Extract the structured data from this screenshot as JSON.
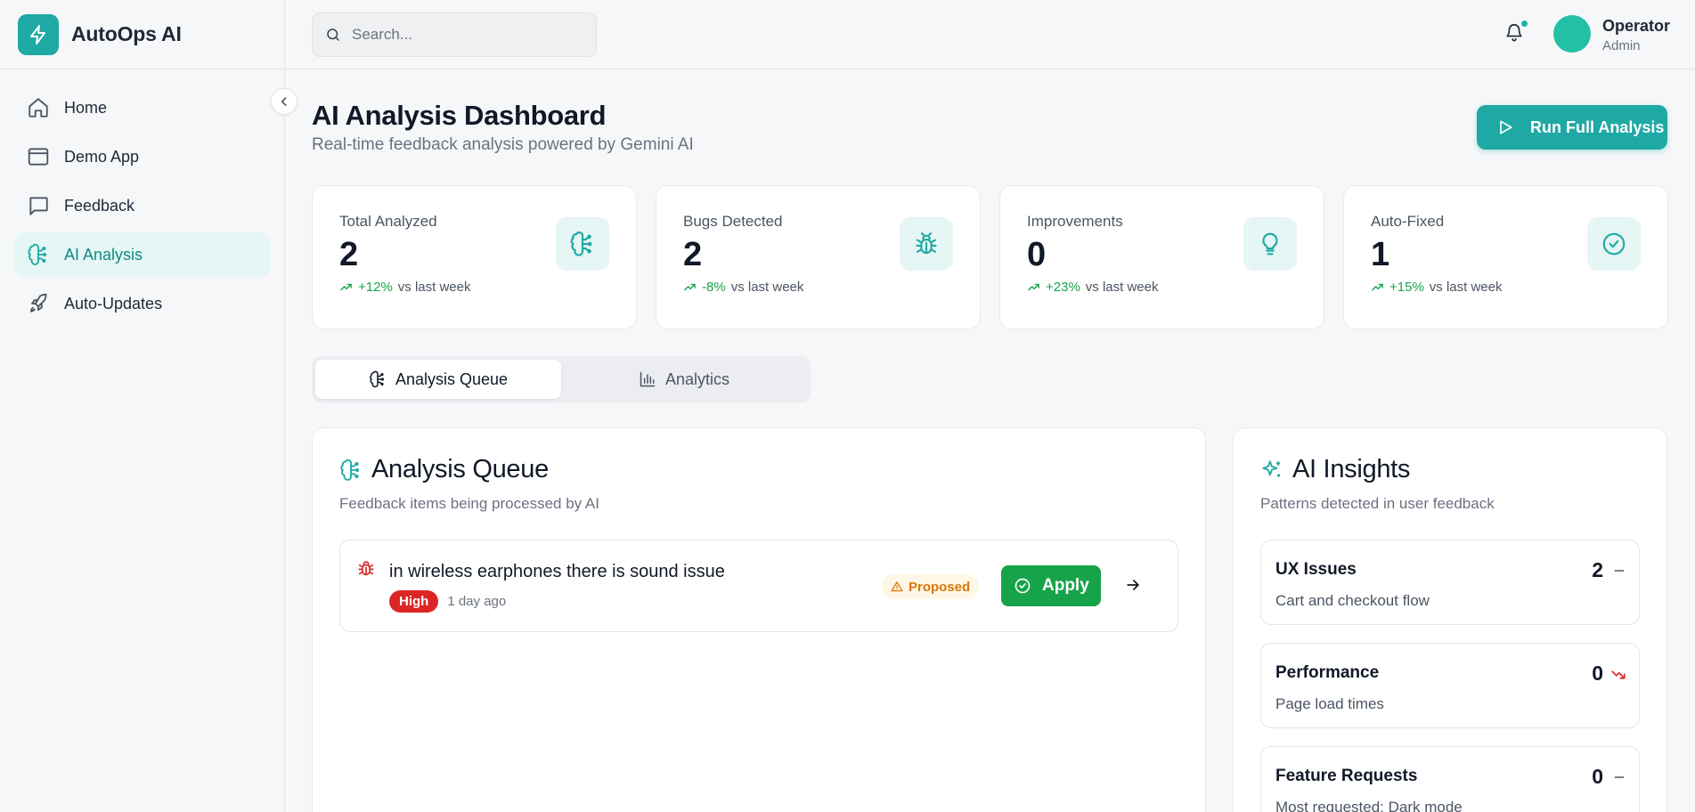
{
  "brand": {
    "name": "AutoOps AI",
    "accent": "#1fa9a5"
  },
  "sidebar": {
    "items": [
      {
        "label": "Home",
        "icon": "home-icon"
      },
      {
        "label": "Demo App",
        "icon": "browser-window-icon"
      },
      {
        "label": "Feedback",
        "icon": "message-square-icon"
      },
      {
        "label": "AI Analysis",
        "icon": "brain-icon",
        "active": true
      },
      {
        "label": "Auto-Updates",
        "icon": "rocket-icon"
      }
    ]
  },
  "topbar": {
    "search_placeholder": "Search...",
    "user": {
      "name": "Operator",
      "role": "Admin"
    }
  },
  "page": {
    "title": "AI Analysis Dashboard",
    "subtitle": "Real-time feedback analysis powered by Gemini AI",
    "run_button": "Run Full Analysis"
  },
  "stats": [
    {
      "label": "Total Analyzed",
      "value": "2",
      "change": "+12%",
      "suffix": "vs last week",
      "icon": "brain-icon"
    },
    {
      "label": "Bugs Detected",
      "value": "2",
      "change": "-8%",
      "suffix": "vs last week",
      "icon": "bug-icon"
    },
    {
      "label": "Improvements",
      "value": "0",
      "change": "+23%",
      "suffix": "vs last week",
      "icon": "lightbulb-icon"
    },
    {
      "label": "Auto-Fixed",
      "value": "1",
      "change": "+15%",
      "suffix": "vs last week",
      "icon": "check-circle-icon"
    }
  ],
  "tabs": [
    {
      "label": "Analysis Queue",
      "active": true
    },
    {
      "label": "Analytics",
      "active": false
    }
  ],
  "queue": {
    "title": "Analysis Queue",
    "subtitle": "Feedback items being processed by AI",
    "items": [
      {
        "title": "in wireless earphones there is sound issue",
        "priority": "High",
        "time": "1 day ago",
        "status": "Proposed",
        "action": "Apply"
      }
    ]
  },
  "insights": {
    "title": "AI Insights",
    "subtitle": "Patterns detected in user feedback",
    "items": [
      {
        "name": "UX Issues",
        "description": "Cart and checkout flow",
        "count": "2",
        "trend": "flat"
      },
      {
        "name": "Performance",
        "description": "Page load times",
        "count": "0",
        "trend": "down"
      },
      {
        "name": "Feature Requests",
        "description": "Most requested: Dark mode",
        "count": "0",
        "trend": "flat"
      }
    ]
  }
}
